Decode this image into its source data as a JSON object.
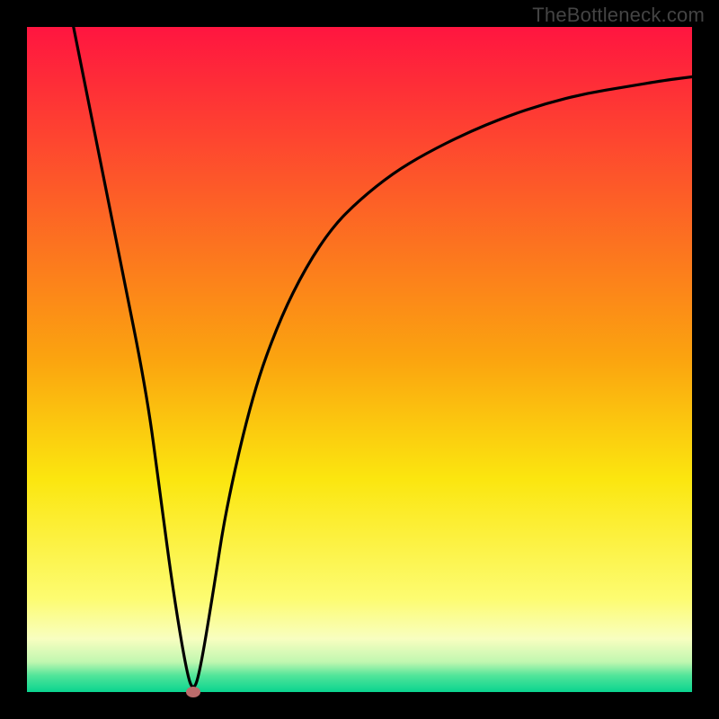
{
  "watermark": "TheBottleneck.com",
  "chart_data": {
    "type": "line",
    "title": "",
    "xlabel": "",
    "ylabel": "",
    "xlim": [
      0,
      100
    ],
    "ylim": [
      0,
      100
    ],
    "series": [
      {
        "name": "curve",
        "x": [
          7,
          10,
          14,
          18,
          20,
          22,
          24,
          25,
          26,
          28,
          30,
          34,
          38,
          42,
          46,
          50,
          55,
          60,
          66,
          72,
          78,
          84,
          90,
          96,
          100
        ],
        "y": [
          100,
          85,
          65,
          45,
          30,
          15,
          3,
          0,
          3,
          15,
          28,
          45,
          56,
          64,
          70,
          74,
          78,
          81,
          84,
          86.5,
          88.5,
          90,
          91,
          92,
          92.5
        ]
      }
    ],
    "marker": {
      "x": 25,
      "y": 0,
      "color": "#bb6b6b"
    },
    "gradient_stops": [
      {
        "offset": 0.0,
        "color": "#ff1540"
      },
      {
        "offset": 0.5,
        "color": "#fba40f"
      },
      {
        "offset": 0.68,
        "color": "#fbe60f"
      },
      {
        "offset": 0.86,
        "color": "#fdfc71"
      },
      {
        "offset": 0.92,
        "color": "#f8fec0"
      },
      {
        "offset": 0.955,
        "color": "#c0f7b0"
      },
      {
        "offset": 0.975,
        "color": "#52e59a"
      },
      {
        "offset": 1.0,
        "color": "#0ad48f"
      }
    ]
  }
}
